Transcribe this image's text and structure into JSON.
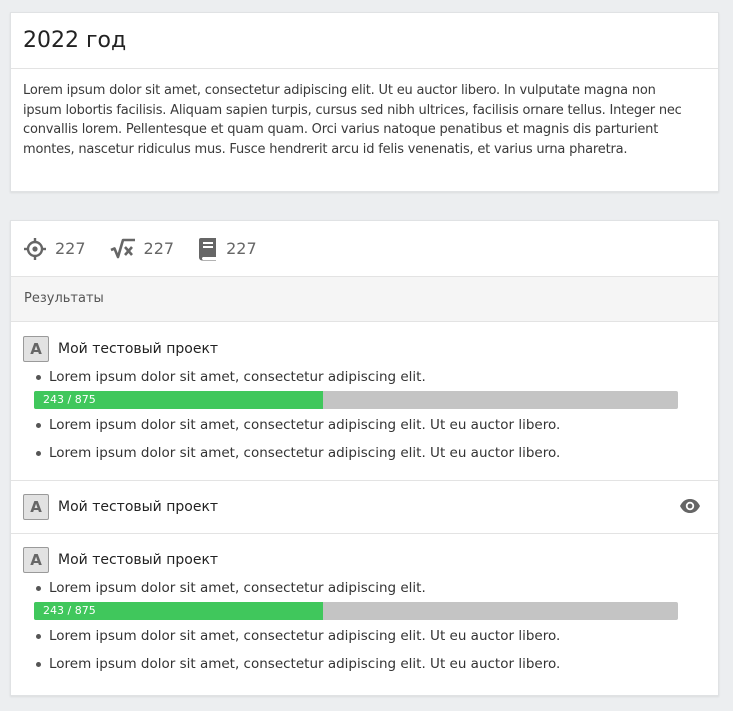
{
  "year_card": {
    "title": "2022 год",
    "description": "Lorem ipsum dolor sit amet, consectetur adipiscing elit. Ut eu auctor libero. In vulputate magna non ipsum lobortis facilisis. Aliquam sapien turpis, cursus sed nibh ultrices, facilisis ornare tellus. Integer nec convallis lorem. Pellentesque et quam quam. Orci varius natoque penatibus et magnis dis parturient montes, nascetur ridiculus mus. Fusce hendrerit arcu id felis venenatis, et varius urna pharetra."
  },
  "stats": [
    {
      "icon": "crosshair-icon",
      "value": "227"
    },
    {
      "icon": "square-root-icon",
      "value": "227"
    },
    {
      "icon": "book-icon",
      "value": "227"
    }
  ],
  "results": {
    "header": "Результаты",
    "projects": [
      {
        "badge": "A",
        "title": "Мой тестовый проект",
        "items": [
          {
            "text": "Lorem ipsum dolor sit amet, consectetur adipiscing elit.",
            "progress_label": "243 / 875",
            "progress": 0.448
          },
          {
            "text": "Lorem ipsum dolor sit amet, consectetur adipiscing elit. Ut eu auctor libero."
          },
          {
            "text": "Lorem ipsum dolor sit amet, consectetur adipiscing elit. Ut eu auctor libero."
          }
        ]
      },
      {
        "badge": "A",
        "title": "Мой тестовый проект",
        "collapsed": true,
        "action_icon": "eye-icon"
      },
      {
        "badge": "A",
        "title": "Мой тестовый проект",
        "items": [
          {
            "text": "Lorem ipsum dolor sit amet, consectetur adipiscing elit.",
            "progress_label": "243 / 875",
            "progress": 0.448
          },
          {
            "text": "Lorem ipsum dolor sit amet, consectetur adipiscing elit. Ut eu auctor libero."
          },
          {
            "text": "Lorem ipsum dolor sit amet, consectetur adipiscing elit. Ut eu auctor libero."
          }
        ]
      }
    ]
  },
  "colors": {
    "progress_fill": "#40c75c",
    "progress_track": "#c4c4c4",
    "badge_bg": "#e2e2e2",
    "icon": "#666666"
  }
}
